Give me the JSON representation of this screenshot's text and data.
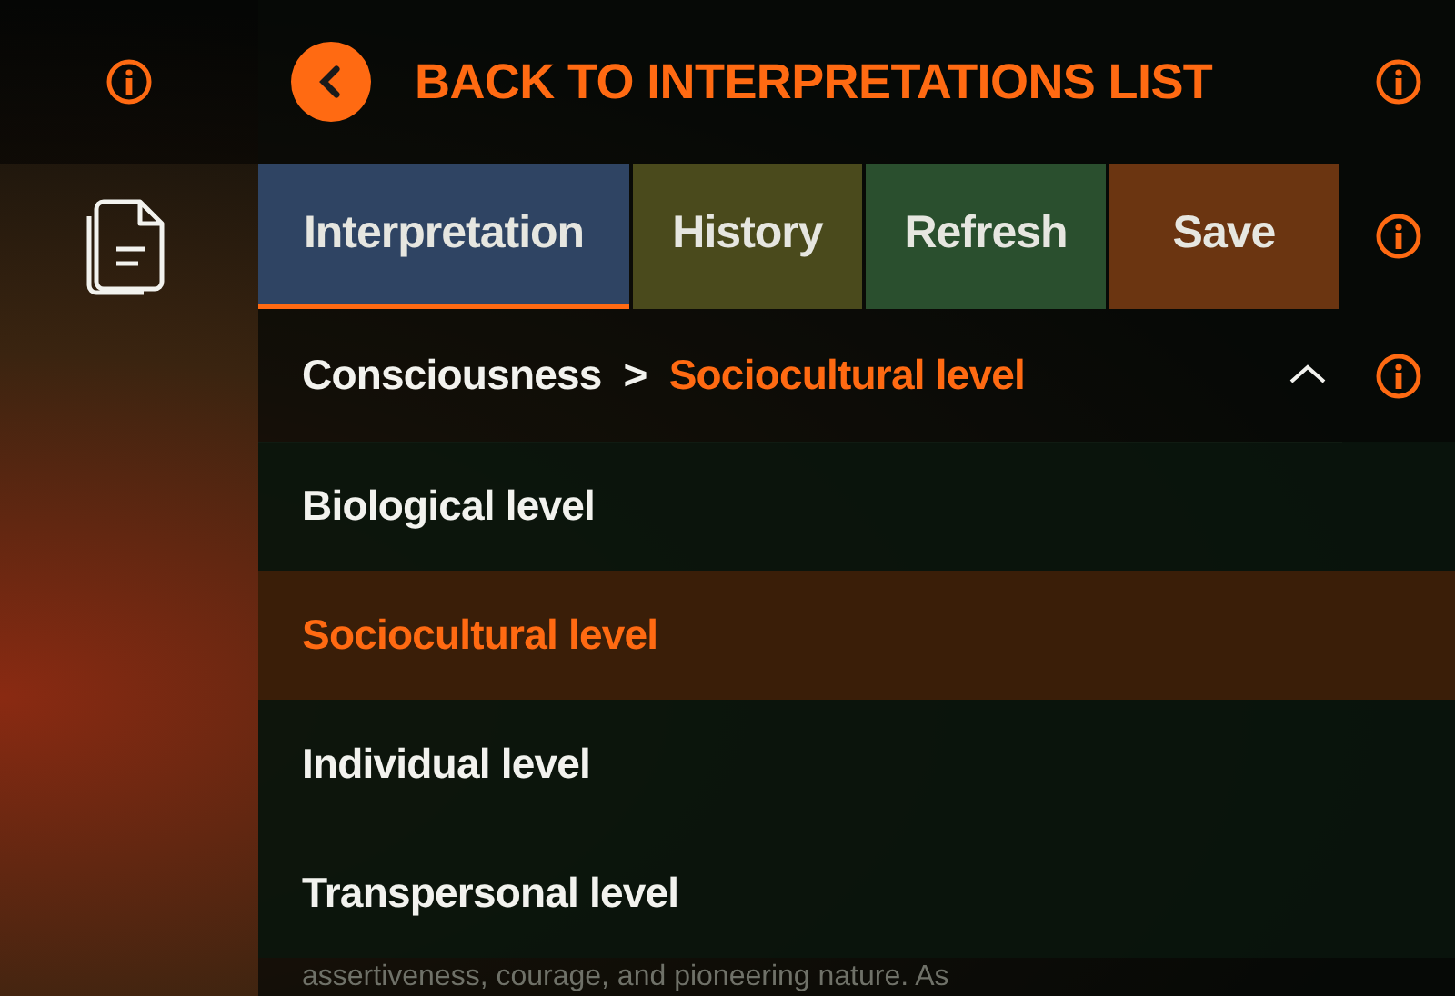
{
  "header": {
    "title": "BACK TO INTERPRETATIONS LIST"
  },
  "tabs": [
    {
      "label": "Interpretation",
      "selected": true,
      "color": "#2f4463"
    },
    {
      "label": "History",
      "selected": false,
      "color": "#4a4a1c"
    },
    {
      "label": "Refresh",
      "selected": false,
      "color": "#2a4f2e"
    },
    {
      "label": "Save",
      "selected": false,
      "color": "#6b3511"
    }
  ],
  "breadcrumb": {
    "parent": "Consciousness",
    "separator": ">",
    "current": "Sociocultural level",
    "expanded": true
  },
  "levels": [
    {
      "label": "Biological level",
      "selected": false
    },
    {
      "label": "Sociocultural level",
      "selected": true
    },
    {
      "label": "Individual level",
      "selected": false
    },
    {
      "label": "Transpersonal level",
      "selected": false
    }
  ],
  "body_text": "assertiveness, courage, and pioneering nature. As"
}
